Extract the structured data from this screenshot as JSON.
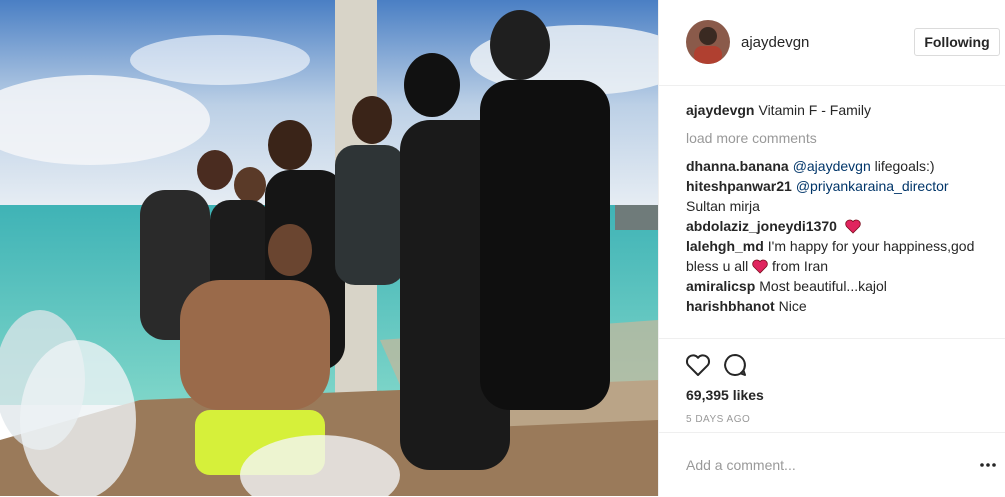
{
  "post": {
    "username": "ajaydevgn",
    "follow_label": "Following",
    "caption_user": "ajaydevgn",
    "caption_text": "Vitamin F - Family",
    "load_more": "load more comments",
    "comments": [
      {
        "user": "dhanna.banana",
        "mention": "@ajaydevgn",
        "text": " lifegoals:)",
        "heart": false
      },
      {
        "user": "hiteshpanwar21",
        "mention": "@priyankaraina_director",
        "text": " Sultan mirja",
        "heart": false
      },
      {
        "user": "abdolaziz_joneydi1370",
        "mention": "",
        "text": "",
        "heart": true
      },
      {
        "user": "lalehgh_md",
        "mention": "",
        "text": "I'm happy for your happiness,god bless u all",
        "text_after": " from Iran",
        "heart": true
      },
      {
        "user": "amiralicsp",
        "mention": "",
        "text": "Most beautiful...kajol",
        "heart": false
      },
      {
        "user": "harishbhanot",
        "mention": "",
        "text": "Nice",
        "heart": false
      }
    ],
    "likes": "69,395 likes",
    "date": "5 DAYS AGO",
    "add_comment_placeholder": "Add a comment..."
  },
  "icons": [
    "heart-outline-icon",
    "comment-bubble-icon",
    "more-options-icon",
    "red-heart-emoji"
  ],
  "colors": {
    "text": "#262626",
    "muted": "#999999",
    "mention": "#003569",
    "border": "#efefef",
    "heart": "#e0245e"
  }
}
